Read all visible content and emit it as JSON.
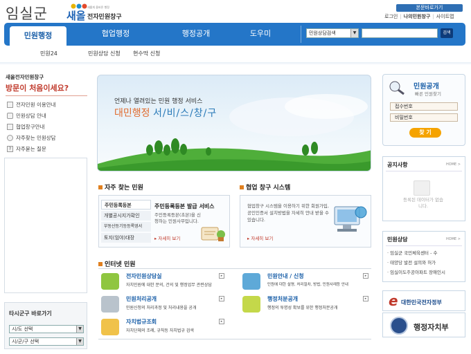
{
  "header": {
    "logo_county": "임실군",
    "logo_brand": "새올",
    "logo_tagline": "새롭게 올바른 행정",
    "logo_sub": "전자민원창구",
    "home_badge": "본문바로가기",
    "util_links": [
      "로그인",
      "나의민원창구",
      "사이트맵"
    ]
  },
  "nav": {
    "tabs": [
      "민원행정",
      "협업행정",
      "행정공개",
      "도우미"
    ],
    "active_index": 0,
    "search_select": "민원상담검색",
    "search_button": "검색",
    "subnav": [
      "민원24",
      "민원상담 신청",
      "현수막 신청"
    ]
  },
  "sidebar": {
    "heading_small": "새올전자민원창구",
    "heading_big": "방문이 처음이세요?",
    "links": [
      "전자민원 이용안내",
      "민원상담 안내",
      "협업창구안내",
      "자주찾는 민원상담",
      "자주묻는 질문"
    ],
    "region_title": "타시군구 바로가기",
    "region_select1": "시/도 선택",
    "region_select2": "시/군/구 선택"
  },
  "hero": {
    "line1": "언제나 열려있는 민원 행정 서비스",
    "line2_a": "대민행정 ",
    "line2_b": "서/비/스/창/구"
  },
  "frequent": {
    "title": "자주 찾는 민원",
    "tabs": [
      "주민등록등본",
      "개별공시지가확인",
      "부동산등기등등록영서",
      "토지(임야)대장"
    ],
    "detail_title": "주민등록등본 발급 서비스",
    "detail_desc": "주민등록등본(초본)을 신청하는 민원사무입니다.",
    "detail_link": "자세히 보기"
  },
  "cooperation": {
    "title": "협업 창구 시스템",
    "desc": "협업창구 시스템을 이용하기 위한 회원가입, 공인인증서 설치방법을 자세히 안내 받을 수 있습니다.",
    "link": "자세히 보기"
  },
  "internet": {
    "title": "인터넷 민원",
    "items": [
      {
        "title": "전자민원상담실",
        "desc": "자치민원에 대한 문의, 건의 및 행정업무 관련상담"
      },
      {
        "title": "민원안내 / 신청",
        "desc": "민원에 대한 설명, 처리절차, 방법, 민원사례등 안내"
      },
      {
        "title": "민원처리공개",
        "desc": "민원신청의 처리과정 및 처리내용을 공개"
      },
      {
        "title": "행정처분공개",
        "desc": "행정의 투명성 확보를 위한 행정처분공개"
      },
      {
        "title": "자치법규조회",
        "desc": "자치단체의 조례, 규칙등 자치법규 검색"
      }
    ]
  },
  "right": {
    "status_title": "민원공개",
    "status_sub": "빠른 민원찾기",
    "receipt_label": "접수번호",
    "password_label": "비밀번호",
    "find_button": "찾 기",
    "notice_title": "공지사항",
    "more": "HOME >",
    "empty_msg": "등록된 데이터가 없습니다.",
    "consult_title": "민원상담",
    "consult_items": [
      "임실군 국민체육센터 - 수",
      "태양당 발전 설의와 허가",
      "임실이도주공아파트 장애인시"
    ],
    "banner1": "대한민국전자정부",
    "banner2": "행정자치부",
    "colors": {
      "brand_blue": "#2476c8",
      "tab_active": "#ffffff",
      "accent_red": "#c0392b",
      "accent_yellow": "#f5a300"
    }
  }
}
